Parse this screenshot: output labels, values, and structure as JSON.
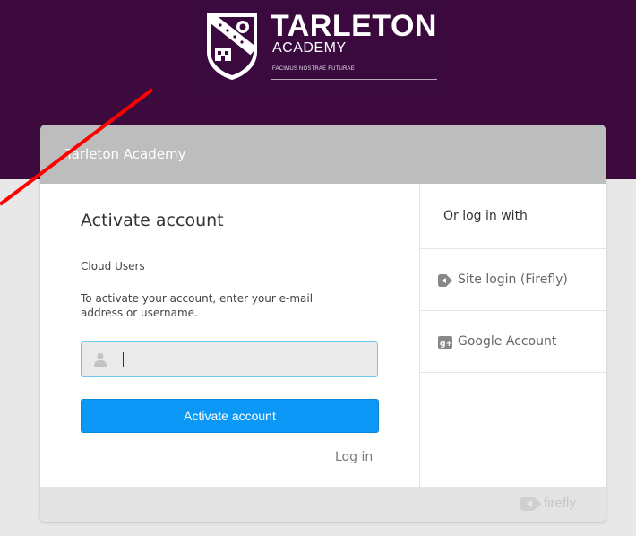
{
  "logo": {
    "name": "TARLETON",
    "subtitle": "ACADEMY",
    "motto": "FACIMUS NOSTRAE FUTURAE"
  },
  "card": {
    "header_title": "Tarleton Academy"
  },
  "form": {
    "title": "Activate account",
    "provider": "Cloud Users",
    "instructions": "To activate your account, enter your e-mail address or username.",
    "input_value": "",
    "input_placeholder": "",
    "submit_label": "Activate account",
    "login_link": "Log in"
  },
  "alt_login": {
    "heading": "Or log in with",
    "options": [
      {
        "label": "Site login (Firefly)",
        "icon": "firefly-icon"
      },
      {
        "label": "Google Account",
        "icon": "google-plus-icon"
      }
    ]
  },
  "footer": {
    "brand": "firefly"
  },
  "colors": {
    "header_band": "#3d0a3e",
    "card_header": "#bdbdbd",
    "button": "#0a97f5",
    "input_focus": "#6fc8f2",
    "annotation_arrow": "#ff0000"
  }
}
